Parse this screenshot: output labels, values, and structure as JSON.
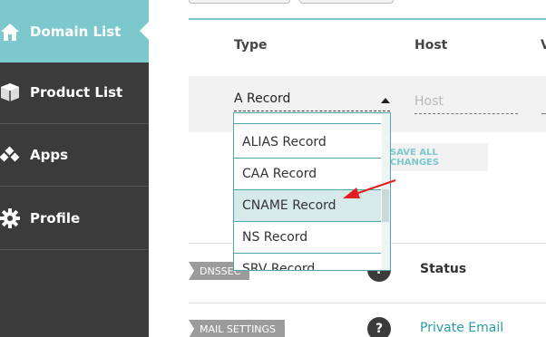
{
  "sidebar": {
    "items": [
      {
        "label": "Domain List",
        "icon": "home-icon",
        "active": true
      },
      {
        "label": "Product List",
        "icon": "box-icon",
        "active": false
      },
      {
        "label": "Apps",
        "icon": "apps-icon",
        "active": false
      },
      {
        "label": "Profile",
        "icon": "gear-icon",
        "active": false
      }
    ]
  },
  "table": {
    "columns": [
      "Type",
      "Host",
      "V"
    ],
    "type_select": {
      "value": "A Record"
    },
    "host_input": {
      "placeholder": "Host"
    }
  },
  "dropdown": {
    "options": [
      "A Record",
      "ALIAS Record",
      "CAA Record",
      "CNAME Record",
      "NS Record",
      "SRV Record"
    ],
    "highlighted": "CNAME Record"
  },
  "actions": {
    "save_all": "SAVE ALL CHANGES"
  },
  "sections": {
    "dnssec": {
      "tag": "DNSSEC",
      "help": "?",
      "label": "Status"
    },
    "mail": {
      "tag": "MAIL SETTINGS",
      "help": "?",
      "value": "Private Email"
    }
  },
  "colors": {
    "accent": "#7cc8cc",
    "sidebar": "#3b3b3b",
    "annotation_arrow": "#e02020"
  }
}
